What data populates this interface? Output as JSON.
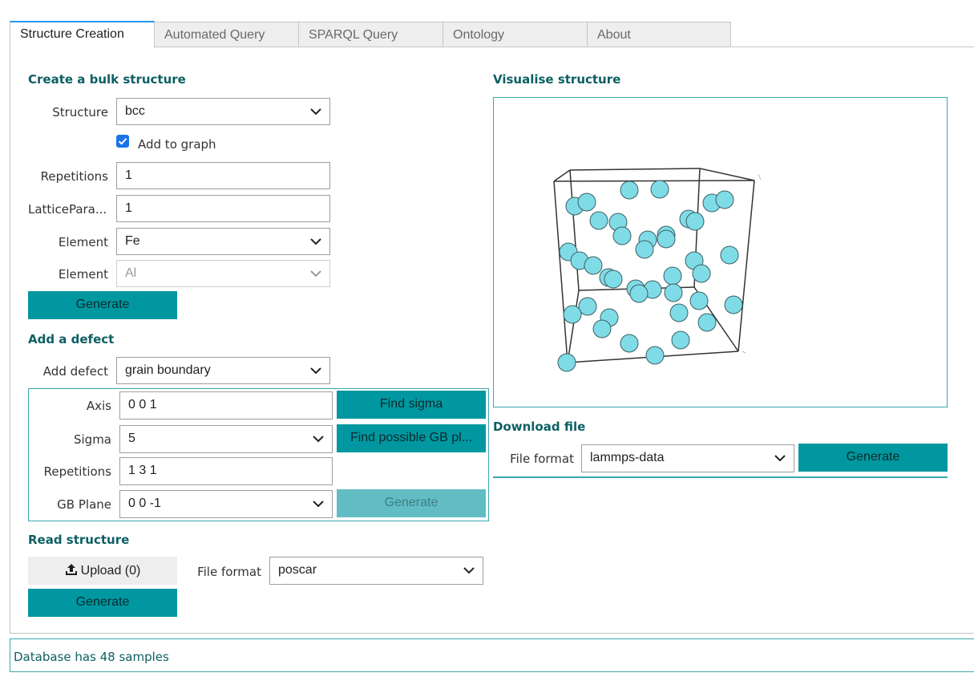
{
  "tabs": [
    {
      "label": "Structure Creation",
      "active": true
    },
    {
      "label": "Automated Query",
      "active": false
    },
    {
      "label": "SPARQL Query",
      "active": false
    },
    {
      "label": "Ontology",
      "active": false
    },
    {
      "label": "About",
      "active": false
    }
  ],
  "bulk": {
    "title": "Create a bulk structure",
    "structure_label": "Structure",
    "structure_value": "bcc",
    "add_to_graph_label": "Add to graph",
    "add_to_graph_checked": true,
    "repetitions_label": "Repetitions",
    "repetitions_value": "1",
    "lattice_label": "LatticePara...",
    "lattice_value": "1",
    "element1_label": "Element",
    "element1_value": "Fe",
    "element2_label": "Element",
    "element2_value": "Al",
    "generate_label": "Generate"
  },
  "defect": {
    "title": "Add a defect",
    "add_defect_label": "Add defect",
    "add_defect_value": "grain boundary",
    "axis_label": "Axis",
    "axis_value": "0 0 1",
    "find_sigma_label": "Find sigma",
    "sigma_label": "Sigma",
    "sigma_value": "5",
    "find_gb_label": "Find possible GB pl...",
    "repetitions_label": "Repetitions",
    "repetitions_value": "1 3 1",
    "gb_plane_label": "GB Plane",
    "gb_plane_value": "0 0 -1",
    "generate_label": "Generate"
  },
  "read": {
    "title": "Read structure",
    "upload_label": "Upload (0)",
    "file_format_label": "File format",
    "file_format_value": "poscar",
    "generate_label": "Generate"
  },
  "visualise": {
    "title": "Visualise structure",
    "atom_color": "#7fdce6"
  },
  "download": {
    "title": "Download file",
    "file_format_label": "File format",
    "file_format_value": "lammps-data",
    "generate_label": "Generate"
  },
  "status": {
    "text": "Database has 48 samples"
  },
  "colors": {
    "accent": "#0097a0",
    "heading": "#0d5f63",
    "tab_active_border": "#2196f3"
  }
}
